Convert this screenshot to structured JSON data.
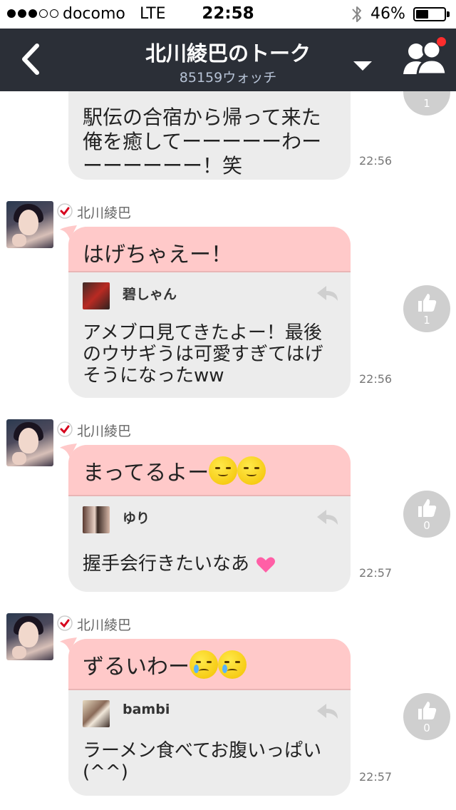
{
  "status_bar": {
    "carrier": "docomo",
    "network": "LTE",
    "time": "22:58",
    "battery": "46%",
    "battery_level": 0.46
  },
  "nav": {
    "title": "北川綾巴のトーク",
    "subtitle": "85159ウォッチ"
  },
  "posts": [
    {
      "text": "駅伝の合宿から帰って来た俺を癒してーーーーーわーーーーーーー！笑",
      "time": "22:56",
      "likes": "1"
    },
    {
      "poster": "北川綾巴",
      "reply": "はげちゃえー！",
      "commenter": "碧しゃん",
      "comment": "アメブロ見てきたよー！最後のウサギうは可愛すぎてはげそうになったww",
      "time": "22:56",
      "likes": "1"
    },
    {
      "poster": "北川綾巴",
      "reply": "まってるよー",
      "commenter": "ゆり",
      "comment": "握手会行きたいなあ",
      "time": "22:57",
      "likes": "0"
    },
    {
      "poster": "北川綾巴",
      "reply": "ずるいわー",
      "commenter": "bambi",
      "comment": "ラーメン食べてお腹いっぱい(^^)",
      "time": "22:57",
      "likes": "0"
    }
  ],
  "colors": {
    "nav_bg": "#2b2f37",
    "reply_bg": "#ffc9c9",
    "bubble_bg": "#ececec",
    "badge": "#ff2d2d",
    "like_bg": "#cfcfcf"
  },
  "icons": [
    "back-chevron-icon",
    "dropdown-arrow-icon",
    "members-icon",
    "verified-check-icon",
    "reply-arrow-icon",
    "thumbs-up-icon",
    "bluetooth-icon",
    "battery-icon"
  ]
}
